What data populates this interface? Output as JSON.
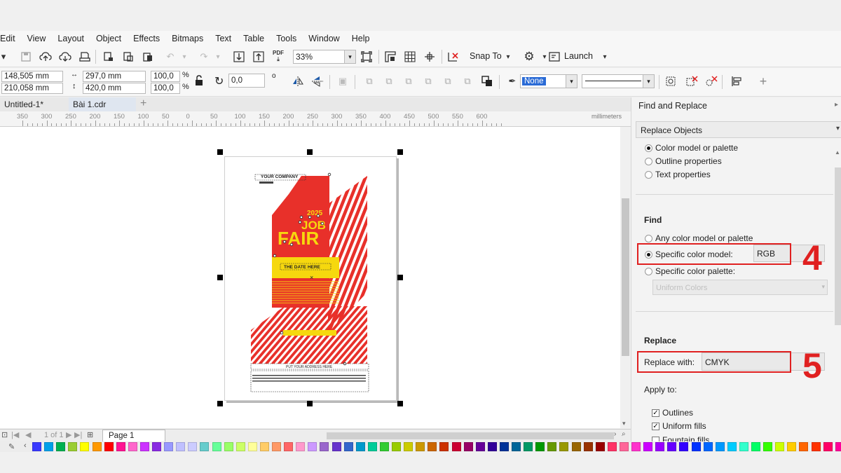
{
  "menu": [
    "Edit",
    "View",
    "Layout",
    "Object",
    "Effects",
    "Bitmaps",
    "Text",
    "Table",
    "Tools",
    "Window",
    "Help"
  ],
  "toolbar": {
    "zoom": "33%",
    "snap_to": "Snap To",
    "launch": "Launch",
    "pdf_label": "PDF"
  },
  "propbar": {
    "x": "148,505 mm",
    "y": "210,058 mm",
    "width": "297,0 mm",
    "height": "420,0 mm",
    "scale_w": "100,0",
    "scale_h": "100,0",
    "percent": "%",
    "rotation": "0,0",
    "degree": "o",
    "outline_fill": "None"
  },
  "tabs": [
    "Untitled-1*",
    "Bài 1.cdr"
  ],
  "ruler": {
    "labels": [
      "350",
      "300",
      "250",
      "200",
      "150",
      "100",
      "50",
      "0",
      "50",
      "100",
      "150",
      "200",
      "250",
      "300",
      "350",
      "400",
      "450",
      "500",
      "550",
      "600"
    ],
    "unit": "millimeters"
  },
  "poster": {
    "company": "YOUR COMPANY",
    "year": "2025",
    "job": "JOB",
    "fair": "FAIR",
    "date": "THE DATE HERE",
    "address": "PUT YOUR ADDRESS HERE",
    "red": "#e8302a",
    "yellow": "#f6d80e"
  },
  "pagenav": {
    "counter": "1 of 1",
    "page": "Page 1"
  },
  "docker": {
    "panel_title": "Find and Replace",
    "mode": "Replace Objects",
    "options": [
      "Color model or palette",
      "Outline properties",
      "Text properties"
    ],
    "find_heading": "Find",
    "find_any": "Any color model or palette",
    "find_specific_model": "Specific color model:",
    "find_model_value": "RGB",
    "find_specific_palette": "Specific color palette:",
    "palette_value": "Uniform Colors",
    "replace_heading": "Replace",
    "replace_with": "Replace with:",
    "replace_value": "CMYK",
    "apply_to": "Apply to:",
    "apply_outlines": "Outlines",
    "apply_uniform": "Uniform fills",
    "apply_fountain": "Fountain fills",
    "step4": "4",
    "step5": "5",
    "accent": "#e02020"
  },
  "palette_colors": [
    "#3a3aff",
    "#00a0e9",
    "#00b050",
    "#9acd32",
    "#ffff00",
    "#ff9900",
    "#ff0000",
    "#ff1493",
    "#ff66cc",
    "#cc33ff",
    "#8a2be2",
    "#9999ff",
    "#c0c0ff",
    "#ccccff",
    "#66cccc",
    "#66ff99",
    "#99ff66",
    "#ccff66",
    "#ffff99",
    "#ffcc66",
    "#ff9966",
    "#ff6666",
    "#ff99cc",
    "#cc99ff",
    "#9966cc",
    "#6633cc",
    "#3366cc",
    "#0099cc",
    "#00cc99",
    "#33cc33",
    "#99cc00",
    "#cccc00",
    "#cc9900",
    "#cc6600",
    "#cc3300",
    "#cc0033",
    "#990066",
    "#660099",
    "#330099",
    "#003399",
    "#006699",
    "#009966",
    "#009900",
    "#669900",
    "#999900",
    "#996600",
    "#993300",
    "#990000",
    "#ff3366",
    "#ff6699",
    "#ff33cc",
    "#cc00ff",
    "#9900ff",
    "#6600ff",
    "#3300ff",
    "#0033ff",
    "#0066ff",
    "#0099ff",
    "#00ccff",
    "#33ffcc",
    "#00ff66",
    "#33ff00",
    "#ccff00",
    "#ffcc00",
    "#ff6600",
    "#ff3300",
    "#ff0066",
    "#ff0099",
    "#e6004c"
  ]
}
